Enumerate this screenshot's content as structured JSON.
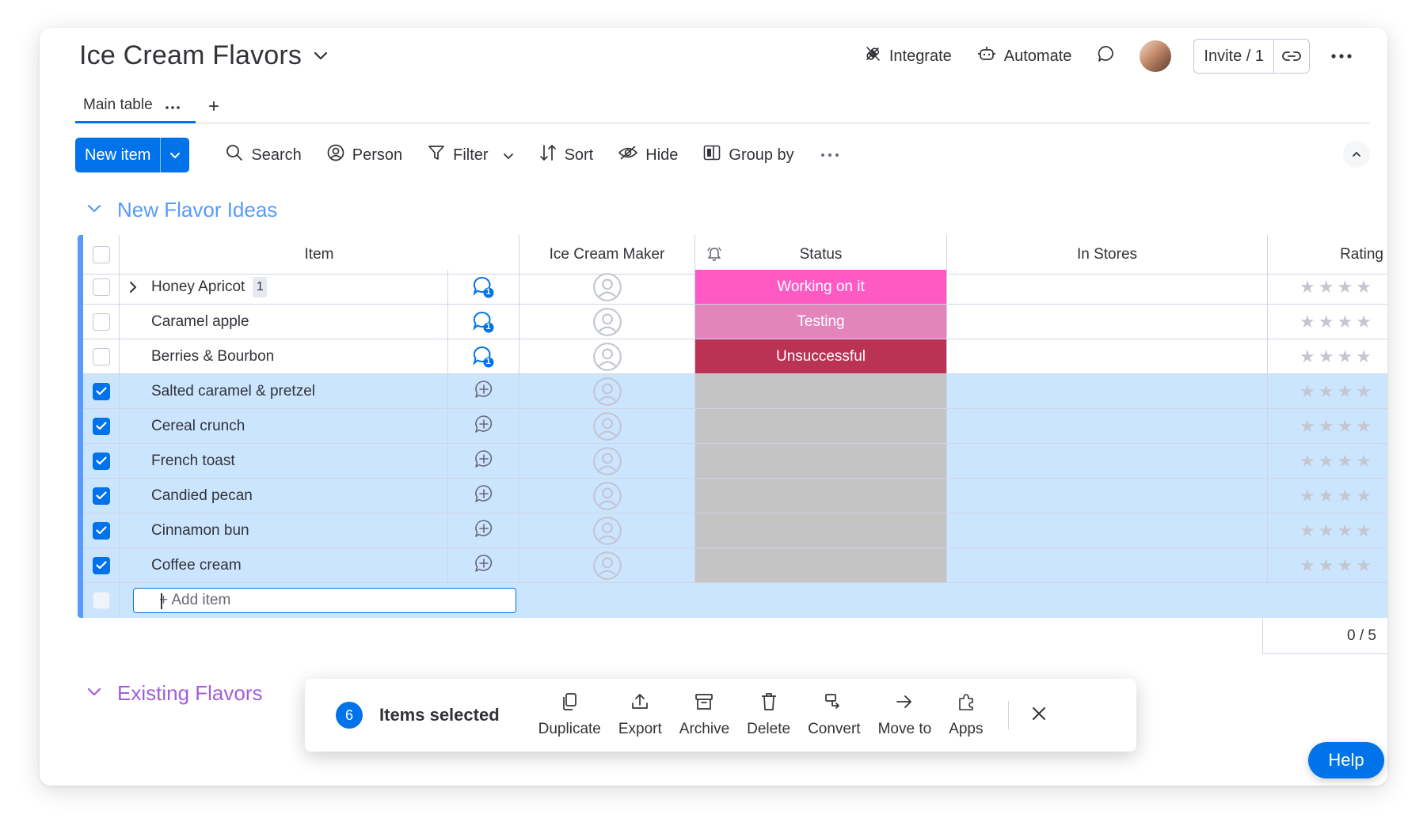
{
  "board": {
    "title": "Ice Cream Flavors"
  },
  "header": {
    "integrate_label": "Integrate",
    "automate_label": "Automate",
    "invite_label": "Invite / 1"
  },
  "tabs": {
    "main_label": "Main table",
    "add_label": "+"
  },
  "toolbar": {
    "new_item_label": "New item",
    "search_label": "Search",
    "person_label": "Person",
    "filter_label": "Filter",
    "sort_label": "Sort",
    "hide_label": "Hide",
    "group_by_label": "Group by"
  },
  "groups": [
    {
      "title": "New Flavor Ideas",
      "color": "#579bfc"
    },
    {
      "title": "Existing Flavors",
      "color": "#a25ddc"
    }
  ],
  "columns": {
    "item": "Item",
    "maker": "Ice Cream Maker",
    "status": "Status",
    "stores": "In Stores",
    "rating": "Rating"
  },
  "rows": [
    {
      "name": "Honey Apricot",
      "subitems": "1",
      "selected": false,
      "updates": "1",
      "status": "Working on it",
      "status_color": "#ff5ac4",
      "has_expand": true
    },
    {
      "name": "Caramel apple",
      "selected": false,
      "updates": "1",
      "status": "Testing",
      "status_color": "#e484bd"
    },
    {
      "name": "Berries & Bourbon",
      "selected": false,
      "updates": "1",
      "status": "Unsuccessful",
      "status_color": "#bb3354"
    },
    {
      "name": "Salted caramel & pretzel",
      "selected": true,
      "updates": "",
      "status": "",
      "status_color": "#c4c4c4"
    },
    {
      "name": "Cereal crunch",
      "selected": true,
      "updates": "",
      "status": "",
      "status_color": "#c4c4c4"
    },
    {
      "name": "French toast",
      "selected": true,
      "updates": "",
      "status": "",
      "status_color": "#c4c4c4"
    },
    {
      "name": "Candied pecan",
      "selected": true,
      "updates": "",
      "status": "",
      "status_color": "#c4c4c4"
    },
    {
      "name": "Cinnamon bun",
      "selected": true,
      "updates": "",
      "status": "",
      "status_color": "#c4c4c4"
    },
    {
      "name": "Coffee cream",
      "selected": true,
      "updates": "",
      "status": "",
      "status_color": "#c4c4c4"
    }
  ],
  "add_item_placeholder": "+ Add item",
  "rating_summary": "0 / 5",
  "action_bar": {
    "count": "6",
    "label": "Items selected",
    "actions": [
      "Duplicate",
      "Export",
      "Archive",
      "Delete",
      "Convert",
      "Move to",
      "Apps"
    ]
  },
  "help_label": "Help",
  "colors": {
    "primary": "#0073ea",
    "selected_row": "#cce5ff",
    "group_blue": "#579bfc",
    "group_purple": "#a25ddc"
  }
}
